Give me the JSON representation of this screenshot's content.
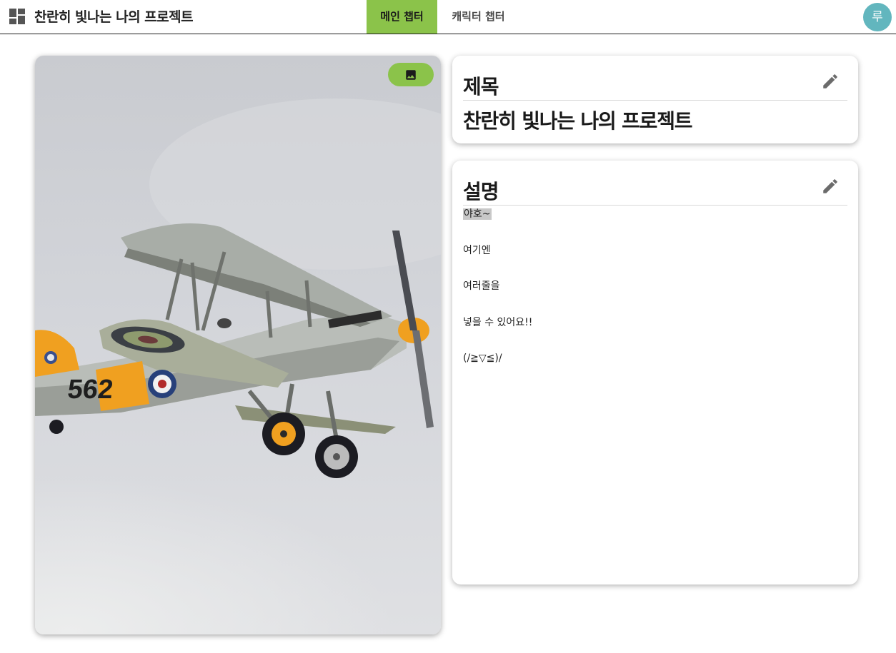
{
  "header": {
    "app_icon": "dashboard-icon",
    "title": "찬란히 빛나는 나의 프로젝트",
    "tabs": [
      {
        "label": "메인 챕터",
        "active": true
      },
      {
        "label": "캐릭터 챕터",
        "active": false
      }
    ],
    "avatar_initial": "루"
  },
  "image_panel": {
    "image_subject": "biplane with roundels and number 562 flying against cloudy sky",
    "aircraft_number": "562",
    "change_image_icon": "image-icon"
  },
  "title_card": {
    "heading": "제목",
    "value": "찬란히 빛나는 나의 프로젝트",
    "edit_icon": "pencil-icon"
  },
  "description_card": {
    "heading": "설명",
    "lines": [
      "야호~",
      "여기엔",
      "여러줄을",
      "넣을 수 있어요!!",
      "(/≧▽≦)/"
    ],
    "edit_icon": "pencil-icon"
  },
  "colors": {
    "accent": "#8bc34a",
    "avatar": "#62b6be",
    "aircraft_orange": "#f0a020"
  }
}
